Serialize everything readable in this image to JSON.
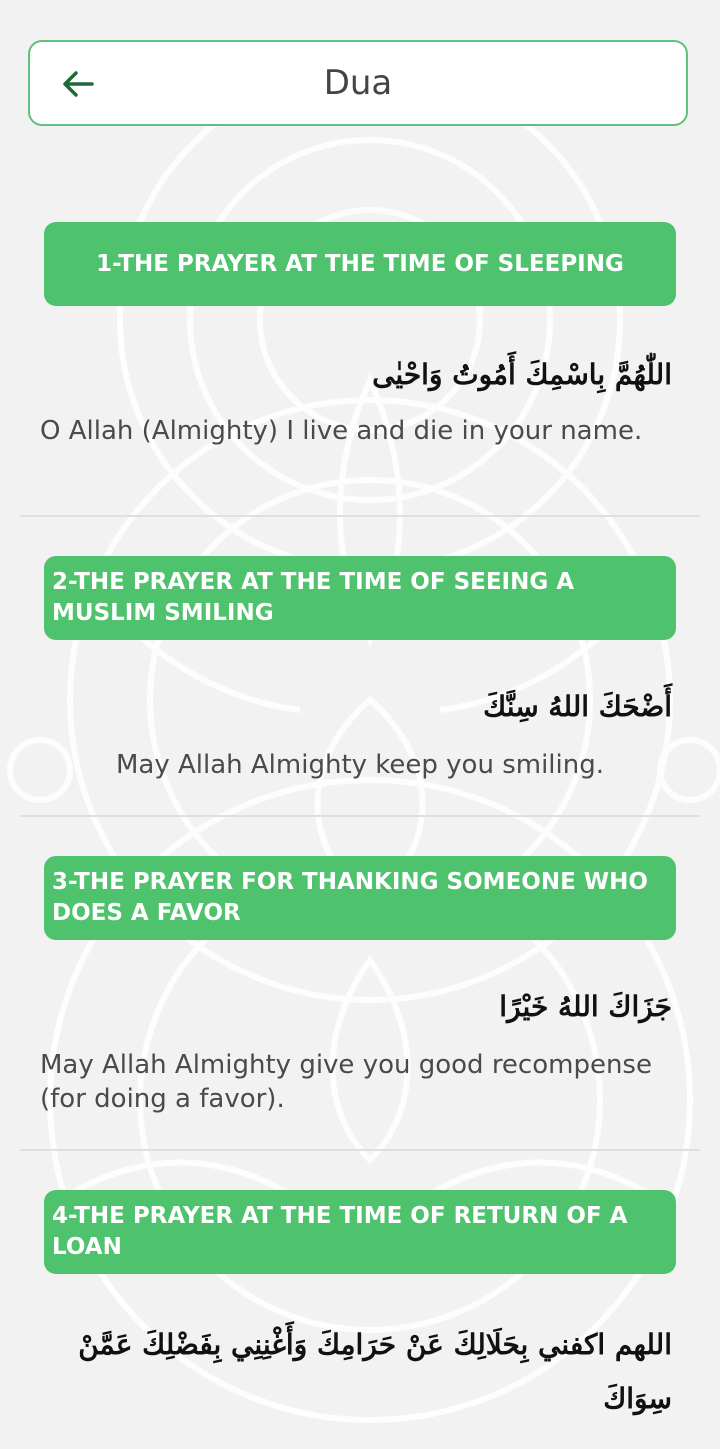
{
  "header": {
    "title": "Dua",
    "back_icon": "arrow-left-icon"
  },
  "colors": {
    "accent": "#4ec26c",
    "header_border": "#5ec27a",
    "back_arrow": "#1f6b35"
  },
  "duas": [
    {
      "title": "1-THE PRAYER AT THE TIME OF SLEEPING",
      "arabic": "اللّٰهُمَّ بِاسْمِكَ أَمُوتُ وَاحْيٰى",
      "translation": "O Allah (Almighty) I live and die in your name."
    },
    {
      "title": "2-THE PRAYER AT THE TIME OF SEEING A MUSLIM SMILING",
      "arabic": "أَضْحَكَ اللهُ سِنَّكَ",
      "translation": "May Allah Almighty keep you smiling."
    },
    {
      "title": "3-THE PRAYER FOR THANKING SOMEONE WHO DOES A FAVOR",
      "arabic": "جَزَاكَ اللهُ خَيْرًا",
      "translation": "May Allah Almighty give you good recompense (for doing a favor)."
    },
    {
      "title": "4-THE PRAYER AT THE TIME OF RETURN OF A LOAN",
      "arabic": "اللهم اكفني بِحَلَالِكَ عَنْ حَرَامِكَ وَأَغْنِنِي بِفَضْلِكَ عَمَّنْ سِوَاكَ",
      "translation": ""
    }
  ]
}
